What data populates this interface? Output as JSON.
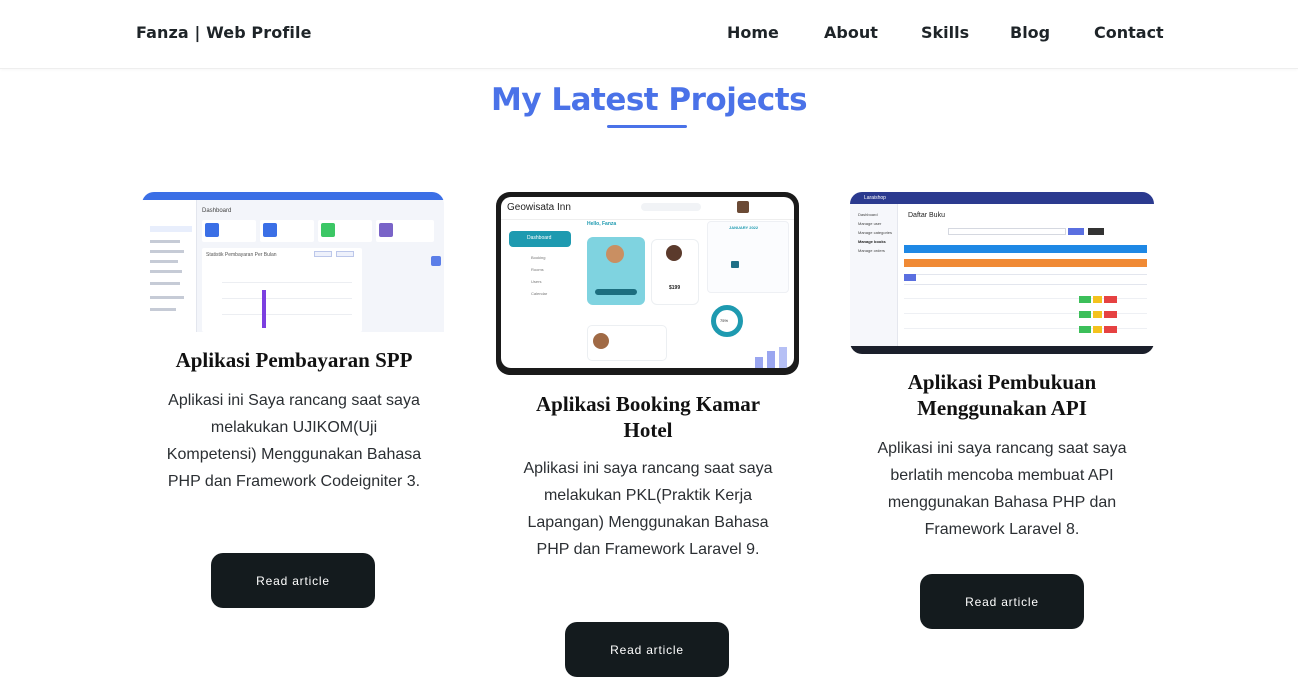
{
  "nav": {
    "brand": "Fanza | Web Profile",
    "links": [
      "Home",
      "About",
      "Skills",
      "Blog",
      "Contact"
    ]
  },
  "section": {
    "title": "My Latest Projects"
  },
  "projects": [
    {
      "title": "Aplikasi Pembayaran SPP",
      "description": "Aplikasi ini Saya rancang saat saya melakukan UJIKOM(Uji Kompetensi) Menggunakan Bahasa PHP dan Framework Codeigniter 3.",
      "button": "Read article",
      "thumbnail": {
        "header": "Dashboard",
        "chart_title": "Statistik Pembayaran Per Bulan",
        "stat_values": [
          "3",
          "2",
          "2",
          "Rp. 900,000"
        ],
        "accent": "#4169e1"
      }
    },
    {
      "title": "Aplikasi Booking Kamar Hotel",
      "description": "Aplikasi ini saya rancang saat saya melakukan PKL(Praktik Kerja Lapangan) Menggunakan Bahasa PHP dan Framework Laravel 9.",
      "button": "Read article",
      "thumbnail": {
        "app_name": "Geowisata Inn",
        "greeting": "Hello, Fanza",
        "menu": [
          "Dashboard",
          "Booking",
          "Rooms",
          "Users",
          "Calendar"
        ],
        "calendar_month": "JANUARY 2022",
        "price": "$199",
        "percent": "75%",
        "accent": "#1e9ab0"
      }
    },
    {
      "title": "Aplikasi Pembukuan Menggunakan API",
      "description": "Aplikasi ini saya rancang saat saya berlatih mencoba membuat API menggunakan Bahasa PHP dan Framework Laravel 8.",
      "button": "Read article",
      "thumbnail": {
        "app_name": "Laraishop",
        "page_title": "Daftar Buku",
        "menu": [
          "Dashboard",
          "Manage user",
          "Manage categories",
          "Manage books",
          "Manage orders"
        ],
        "accent": "#2b3a8f"
      }
    }
  ]
}
